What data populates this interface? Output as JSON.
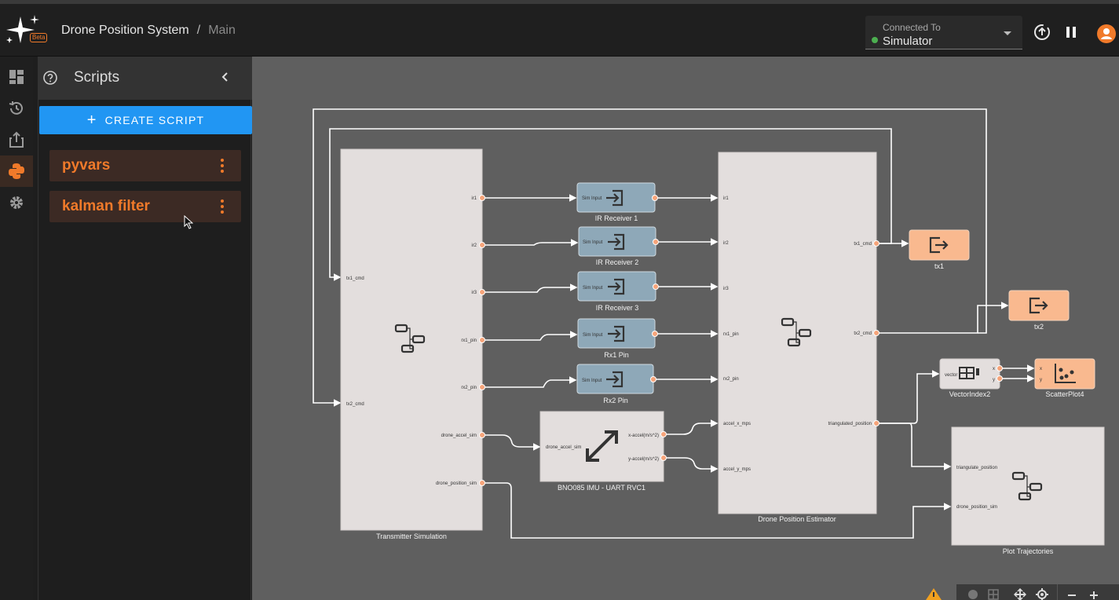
{
  "header": {
    "logo_badge": "Beta",
    "breadcrumb_project": "Drone Position System",
    "breadcrumb_separator": "/",
    "breadcrumb_page": "Main",
    "connection_label": "Connected To",
    "connection_value": "Simulator",
    "connection_status_color": "#4caf50",
    "accent_color": "#f07a2a"
  },
  "rail": {
    "items": [
      "dashboard-icon",
      "history-icon",
      "export-icon",
      "python-icon",
      "gear-icon"
    ],
    "active": "python-icon"
  },
  "panel": {
    "title": "Scripts",
    "create_label": "CREATE SCRIPT",
    "scripts": [
      {
        "name": "pyvars"
      },
      {
        "name": "kalman filter"
      }
    ]
  },
  "canvas": {
    "nodes": {
      "transmitter": {
        "label": "Transmitter Simulation",
        "inputs": [
          "tx1_cmd",
          "tx2_cmd"
        ],
        "outputs": [
          "ir1",
          "ir2",
          "ir3",
          "rx1_pin",
          "rx2_pin",
          "drone_accel_sim",
          "drone_position_sim"
        ]
      },
      "ir1": {
        "label": "IR Receiver 1",
        "port": "Sim Input"
      },
      "ir2": {
        "label": "IR Receiver 2",
        "port": "Sim Input"
      },
      "ir3": {
        "label": "IR Receiver 3",
        "port": "Sim Input"
      },
      "rx1": {
        "label": "Rx1 Pin",
        "port": "Sim Input"
      },
      "rx2": {
        "label": "Rx2 Pin",
        "port": "Sim Input"
      },
      "imu": {
        "label": "BNO085 IMU - UART RVC1",
        "input": "drone_accel_sim",
        "outputs": [
          "x-accel(m/s^2)",
          "y-accel(m/s^2)"
        ]
      },
      "estimator": {
        "label": "Drone Position Estimator",
        "inputs": [
          "ir1",
          "ir2",
          "ir3",
          "rx1_pin",
          "rx2_pin",
          "accel_x_mps",
          "accel_y_mps"
        ],
        "outputs": [
          "tx1_cmd",
          "tx2_cmd",
          "triangulated_position"
        ]
      },
      "tx1": {
        "label": "tx1"
      },
      "tx2": {
        "label": "tx2"
      },
      "vector": {
        "label": "VectorIndex2",
        "input": "vector",
        "outputs": [
          "x",
          "y"
        ]
      },
      "scatter": {
        "label": "ScatterPlot4",
        "inputs": [
          "x",
          "y"
        ]
      },
      "plot": {
        "label": "Plot Trajectories",
        "inputs": [
          "triangulate_position",
          "drone_position_sim"
        ]
      }
    }
  }
}
